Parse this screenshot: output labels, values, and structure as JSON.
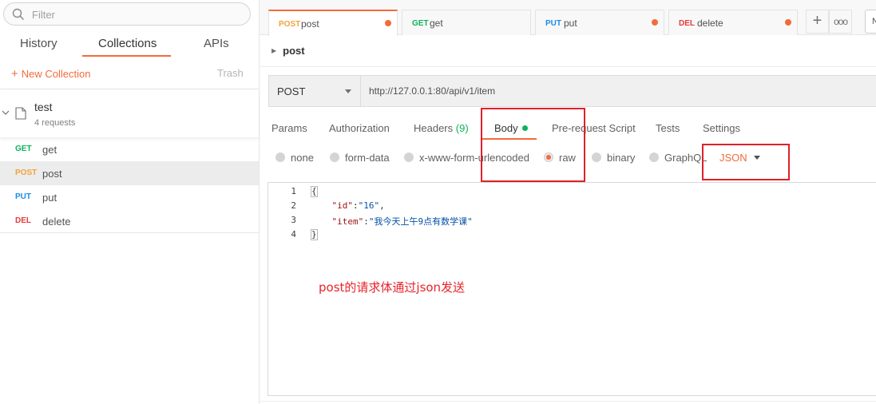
{
  "sidebar": {
    "search_placeholder": "Filter",
    "tabs": [
      {
        "label": "History"
      },
      {
        "label": "Collections"
      },
      {
        "label": "APIs"
      }
    ],
    "new_collection": "New Collection",
    "trash": "Trash",
    "collection": {
      "name": "test",
      "count": "4 requests"
    },
    "requests": [
      {
        "method": "GET",
        "name": "get"
      },
      {
        "method": "POST",
        "name": "post"
      },
      {
        "method": "PUT",
        "name": "put"
      },
      {
        "method": "DEL",
        "name": "delete"
      }
    ]
  },
  "tabs": [
    {
      "method": "POST",
      "name": "post"
    },
    {
      "method": "GET",
      "name": "get"
    },
    {
      "method": "PUT",
      "name": "put"
    },
    {
      "method": "DEL",
      "name": "delete"
    }
  ],
  "tab_buttons": {
    "add": "+",
    "more": "ooo",
    "edge": "N"
  },
  "request": {
    "breadcrumb": "post",
    "method": "POST",
    "url": "http://127.0.0.1:80/api/v1/item"
  },
  "config_tabs": {
    "params": "Params",
    "authorization": "Authorization",
    "headers": "Headers",
    "headers_count": "(9)",
    "body": "Body",
    "pre_request": "Pre-request Script",
    "tests": "Tests",
    "settings": "Settings"
  },
  "body_types": {
    "none": "none",
    "form_data": "form-data",
    "urlencoded": "x-www-form-urlencoded",
    "raw": "raw",
    "binary": "binary",
    "graphql": "GraphQL",
    "language": "JSON"
  },
  "editor": {
    "line_numbers": [
      "1",
      "2",
      "3",
      "4"
    ],
    "lines": {
      "l1": "{",
      "id_key": "\"id\"",
      "id_val": "\"16\"",
      "item_key": "\"item\"",
      "item_val": "\"我今天上午9点有数学课\"",
      "l4": "}"
    }
  },
  "annotation": "post的请求体通过json发送",
  "colors": {
    "accent": "#f26b3a",
    "get": "#0cb35c",
    "post": "#f2a33a",
    "put": "#1a8ce6",
    "del": "#e63a3a",
    "annotation_red": "#e0202a"
  }
}
